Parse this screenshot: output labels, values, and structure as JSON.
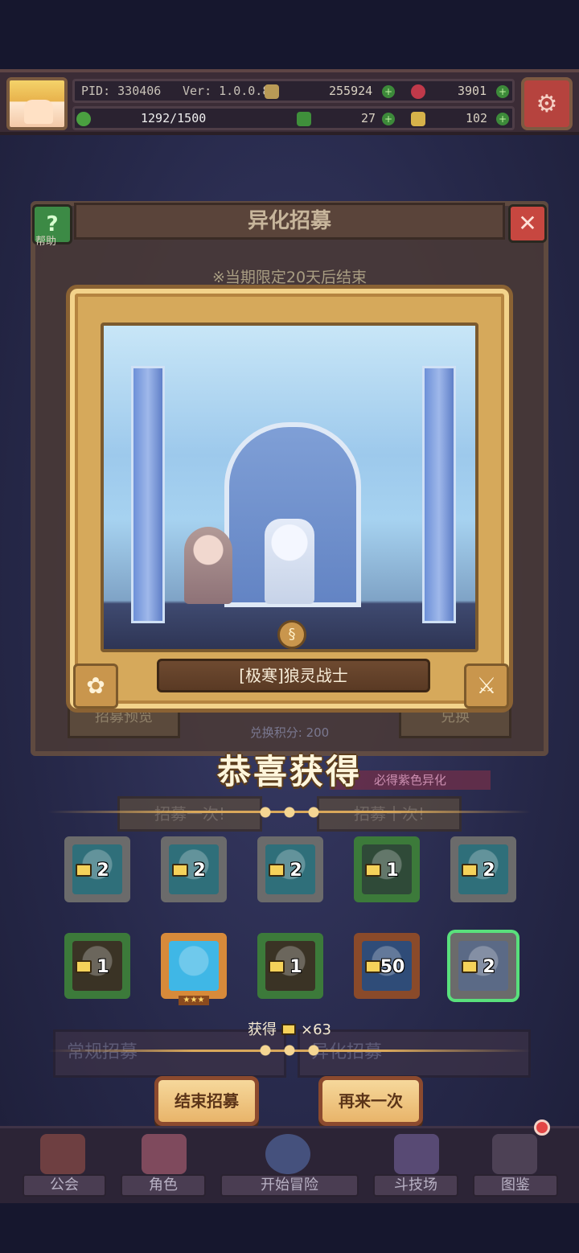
{
  "hud": {
    "pid": "PID: 330406",
    "version": "Ver: 1.0.0.8",
    "gold": "255924",
    "gems": "3901",
    "stamina": "1292/1500",
    "clover": "27",
    "keys": "102"
  },
  "background": {
    "title": "异化招募",
    "help_label": "帮助",
    "notice": "※当期限定20天后结束",
    "preview_button": "招募预览",
    "exchange_button": "兑换",
    "exchange_points": "兑换积分: 200",
    "pity_text": "必得紫色异化",
    "recruit_once": "招募一次!",
    "recruit_ten": "招募十次!",
    "tab_regular": "常规招募",
    "tab_mutant": "异化招募"
  },
  "featured": {
    "name": "[极寒]狼灵战士"
  },
  "congrats": "恭喜获得",
  "items": [
    {
      "qty": "2",
      "color": "#2f6f7a",
      "border": "#6b6b6b",
      "stars": ""
    },
    {
      "qty": "2",
      "color": "#2f6f7a",
      "border": "#6b6b6b",
      "stars": ""
    },
    {
      "qty": "2",
      "color": "#2f6f7a",
      "border": "#6b6b6b",
      "stars": ""
    },
    {
      "qty": "1",
      "color": "#2f4a38",
      "border": "#3c7a3a",
      "stars": ""
    },
    {
      "qty": "2",
      "color": "#2f6f7a",
      "border": "#6b6b6b",
      "stars": ""
    },
    {
      "qty": "1",
      "color": "#3a3325",
      "border": "#3c7a3a",
      "stars": ""
    },
    {
      "qty": "",
      "color": "#3fb7e6",
      "border": "#d78a3a",
      "stars": "★★★"
    },
    {
      "qty": "1",
      "color": "#3a3325",
      "border": "#3c7a3a",
      "stars": ""
    },
    {
      "qty": "50",
      "color": "#2f4c78",
      "border": "#8a4a2a",
      "stars": ""
    },
    {
      "qty": "2",
      "color": "#5b6a86",
      "border": "#6b6b6b",
      "stars": ""
    }
  ],
  "total": {
    "label": "获得",
    "amount": "×63"
  },
  "buttons": {
    "end": "结束招募",
    "again": "再来一次"
  },
  "nav": {
    "guild": "公会",
    "character": "角色",
    "adventure": "开始冒险",
    "arena": "斗技场",
    "codex": "图鉴"
  },
  "icons": [
    "settings-icon",
    "gold-coin-icon",
    "gem-icon",
    "clover-icon",
    "key-icon",
    "help-icon",
    "close-icon",
    "paw-icon",
    "sword-icon",
    "folder-icon"
  ]
}
